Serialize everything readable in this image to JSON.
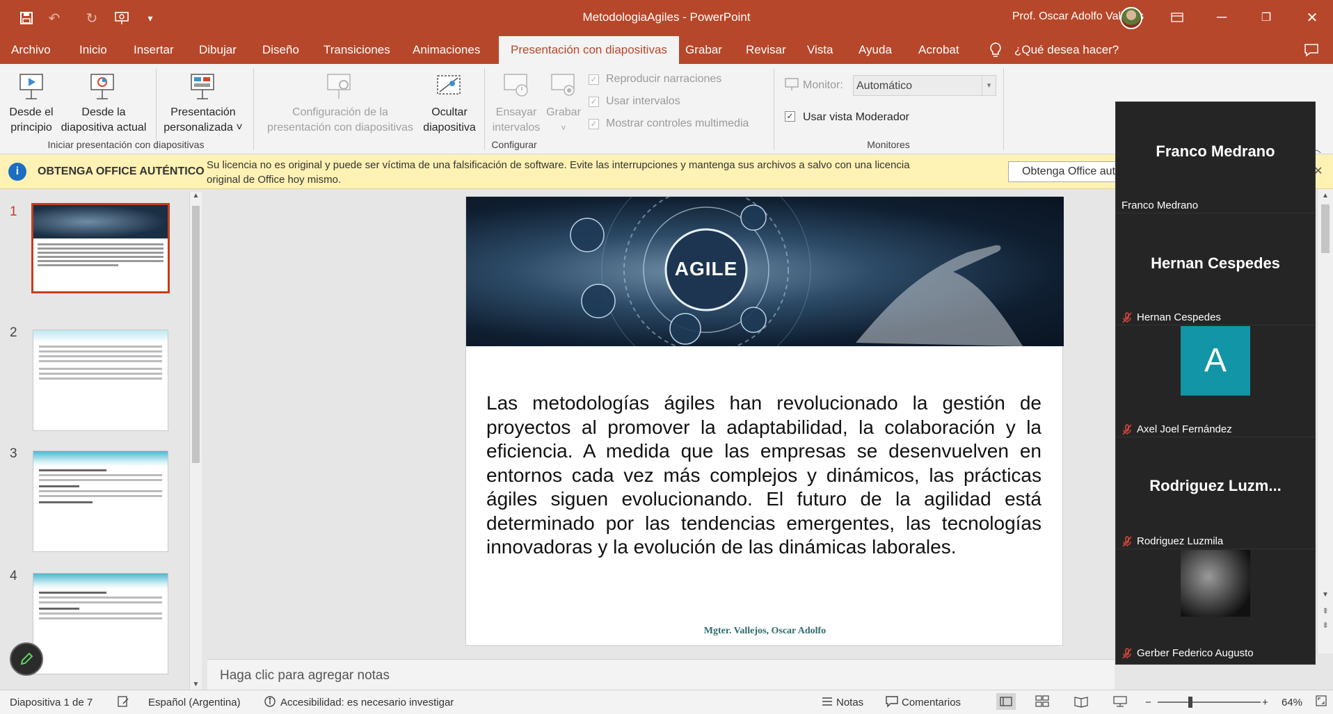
{
  "titlebar": {
    "doc_title": "MetodologiaAgiles  -  PowerPoint",
    "user_name": "Prof. Oscar Adolfo Vallejos",
    "qat_icons": [
      "save-icon",
      "undo-icon",
      "redo-icon",
      "start-from-beginning-icon",
      "customize-qat-icon"
    ]
  },
  "tabs": [
    "Archivo",
    "Inicio",
    "Insertar",
    "Dibujar",
    "Diseño",
    "Transiciones",
    "Animaciones",
    "Presentación con diapositivas",
    "Grabar",
    "Revisar",
    "Vista",
    "Ayuda",
    "Acrobat"
  ],
  "active_tab_index": 7,
  "tell_me": "¿Qué desea hacer?",
  "ribbon": {
    "from_beginning": [
      "Desde el",
      "principio"
    ],
    "from_current": [
      "Desde la",
      "diapositiva actual"
    ],
    "custom_show": [
      "Presentación",
      "personalizada ˅"
    ],
    "group_start": "Iniciar presentación con diapositivas",
    "setup": [
      "Configuración de la",
      "presentación con diapositivas"
    ],
    "hide_slide": [
      "Ocultar",
      "diapositiva"
    ],
    "rehearse": [
      "Ensayar",
      "intervalos"
    ],
    "record": [
      "Grabar",
      "˅"
    ],
    "play_narrations": "Reproducir narraciones",
    "use_timings": "Usar intervalos",
    "show_media": "Mostrar controles multimedia",
    "group_setup": "Configurar",
    "monitor_label": "Monitor:",
    "monitor_value": "Automático",
    "presenter_view": "Usar vista Moderador",
    "group_monitors": "Monitores"
  },
  "license_bar": {
    "title": "OBTENGA OFFICE AUTÉNTICO",
    "message_line1": "Su licencia no es original y puede ser víctima de una falsificación de software. Evite las interrupciones y mantenga sus archivos a salvo con una licencia",
    "message_line2": "original de Office hoy mismo.",
    "button": "Obtenga Office auténtico"
  },
  "slides_panel": {
    "numbers": [
      "1",
      "2",
      "3",
      "4"
    ],
    "selected": 1
  },
  "slide": {
    "banner_text": "AGILE",
    "body": "Las metodologías ágiles han revolucionado la gestión de proyectos al promover la adaptabilidad, la colaboración y la eficiencia. A medida que las empresas se desenvuelven en entornos cada vez más complejos y dinámicos, las prácticas ágiles siguen evolucionando. El futuro de la agilidad está determinado por las tendencias emergentes, las tecnologías innovadoras y la evolución de las dinámicas laborales.",
    "footer": "Mgter. Vallejos, Oscar Adolfo"
  },
  "notes_placeholder": "Haga clic para agregar notas",
  "status": {
    "slide_info": "Diapositiva 1 de 7",
    "language": "Español (Argentina)",
    "accessibility": "Accesibilidad: es necesario investigar",
    "notes": "Notas",
    "comments": "Comentarios",
    "zoom": "64%"
  },
  "meeting": {
    "participants": [
      {
        "big": "Franco Medrano",
        "label": "Franco Medrano",
        "muted": false,
        "type": "name"
      },
      {
        "big": "Hernan Cespedes",
        "label": "Hernan Cespedes",
        "muted": true,
        "type": "name"
      },
      {
        "big": "A",
        "label": "Axel Joel Fernández",
        "muted": true,
        "type": "avatar"
      },
      {
        "big": "Rodriguez Luzm...",
        "label": "Rodriguez Luzmila",
        "muted": true,
        "type": "name"
      },
      {
        "big": "",
        "label": "Gerber Federico Augusto",
        "muted": true,
        "type": "image"
      }
    ],
    "avatar_color": "#1295a6"
  },
  "colors": {
    "accent": "#b7472a",
    "license_bg": "#fff2b4"
  }
}
